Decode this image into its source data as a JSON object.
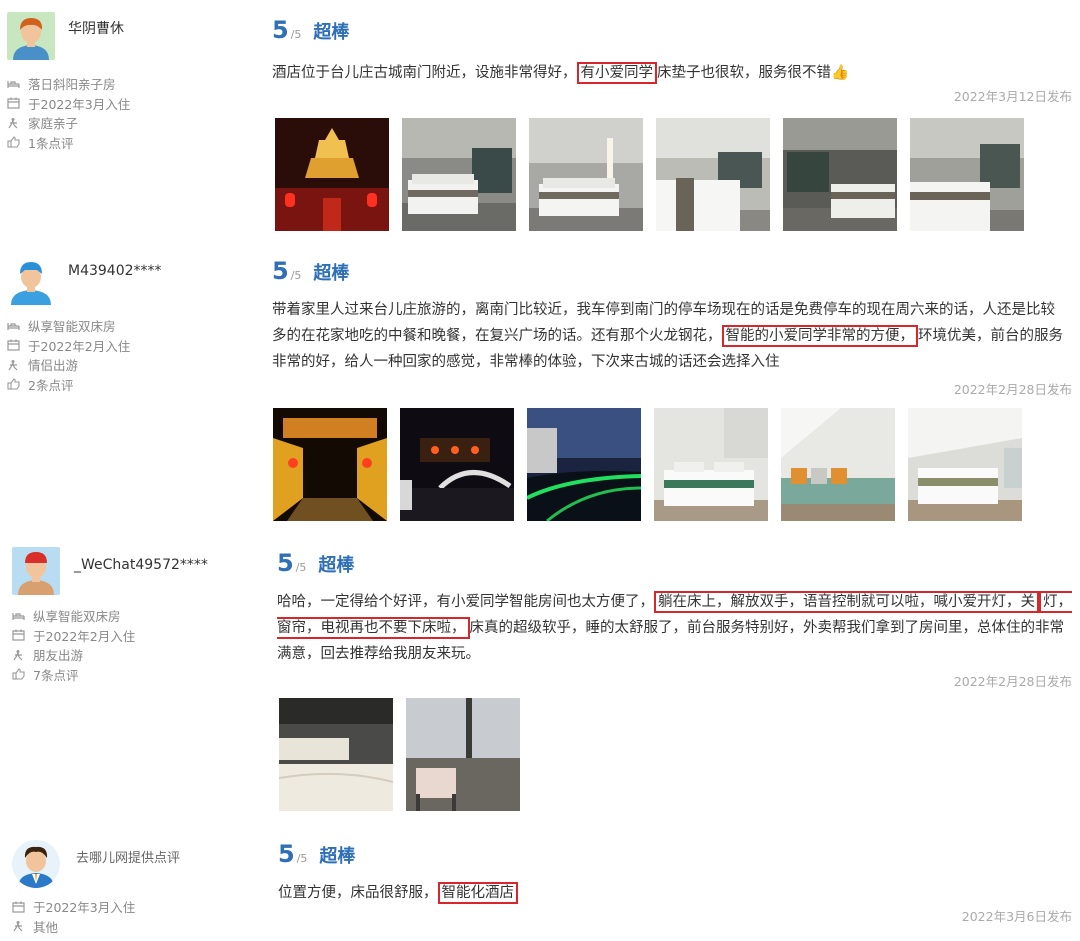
{
  "reviews": [
    {
      "username": "华阴曹休",
      "room": "落日斜阳亲子房",
      "checkin": "于2022年3月入住",
      "trip": "家庭亲子",
      "count": "1条点评",
      "score": "5",
      "score_of": "/5",
      "score_word": "超棒",
      "text_before": "酒店位于台儿庄古城南门附近，设施非常得好，",
      "highlight": "有小爱同学",
      "text_after": "床垫子也很软，服务很不错👍",
      "date": "2022年3月12日发布",
      "photos": [
        "ancient-tower-night",
        "hotel-room-1",
        "hotel-room-2",
        "hotel-room-3",
        "hotel-room-4",
        "hotel-room-5"
      ]
    },
    {
      "username": "M439402****",
      "room": "纵享智能双床房",
      "checkin": "于2022年2月入住",
      "trip": "情侣出游",
      "count": "2条点评",
      "score": "5",
      "score_of": "/5",
      "score_word": "超棒",
      "text_before": "带着家里人过来台儿庄旅游的，离南门比较近，我车停到南门的停车场现在的话是免费停车的现在周六来的话，人还是比较多的在花家地吃的中餐和晚餐，在复兴广场的话。还有那个火龙钢花，",
      "highlight": "智能的小爱同学非常的方便，",
      "text_after": "环境优美，前台的服务非常的好，给人一种回家的感觉，非常棒的体验，下次来古城的话还会选择入住",
      "date": "2022年2月28日发布",
      "photos": [
        "lantern-corridor",
        "bridge-night",
        "canal-night",
        "hotel-room-6",
        "sofa-room",
        "attic-room"
      ]
    },
    {
      "username": "_WeChat49572****",
      "room": "纵享智能双床房",
      "checkin": "于2022年2月入住",
      "trip": "朋友出游",
      "count": "7条点评",
      "score": "5",
      "score_of": "/5",
      "score_word": "超棒",
      "text_before": "哈哈，一定得给个好评，有小爱同学智能房间也太方便了，",
      "highlight_a": "躺在床上，解放双手，语音控制就可以啦，喊小爱开灯，关",
      "highlight_b": "灯，窗帘，电视再也不要下床啦，",
      "text_after": "床真的超级软乎，睡的太舒服了，前台服务特别好，外卖帮我们拿到了房间里，总体住的非常满意，回去推荐给我朋友来玩。",
      "date": "2022年2月28日发布",
      "photos": [
        "twin-beds-dark",
        "window-chair"
      ]
    },
    {
      "username": "去哪儿网提供点评",
      "checkin": "于2022年3月入住",
      "trip": "其他",
      "score": "5",
      "score_of": "/5",
      "score_word": "超棒",
      "text_before": "位置方便，床品很舒服，",
      "highlight": "智能化酒店",
      "date": "2022年3月6日发布"
    }
  ]
}
